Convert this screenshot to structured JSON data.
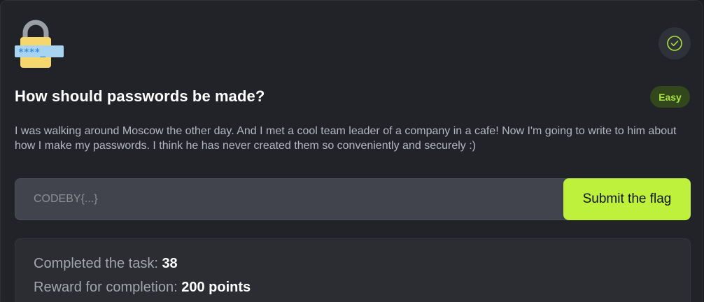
{
  "task": {
    "icon": "lock-password-icon",
    "lock_mask_text": "****_",
    "title": "How should passwords be made?",
    "difficulty": "Easy",
    "description": "I was walking around Moscow the other day. And I met a cool team leader of a company in a cafe! Now I'm going to write to him about how I make my passwords. I think he has never created them so conveniently and securely :)"
  },
  "status_icon": "check-circle-icon",
  "flag_form": {
    "placeholder": "CODEBY{...}",
    "value": "",
    "submit_label": "Submit the flag"
  },
  "stats": {
    "completed_label": "Completed the task: ",
    "completed_value": "38",
    "reward_label": "Reward for completion: ",
    "reward_value": "200 points"
  },
  "colors": {
    "accent": "#bdf13c",
    "badge_text": "#a7e33d",
    "badge_bg": "#33471c",
    "background": "#222328"
  }
}
